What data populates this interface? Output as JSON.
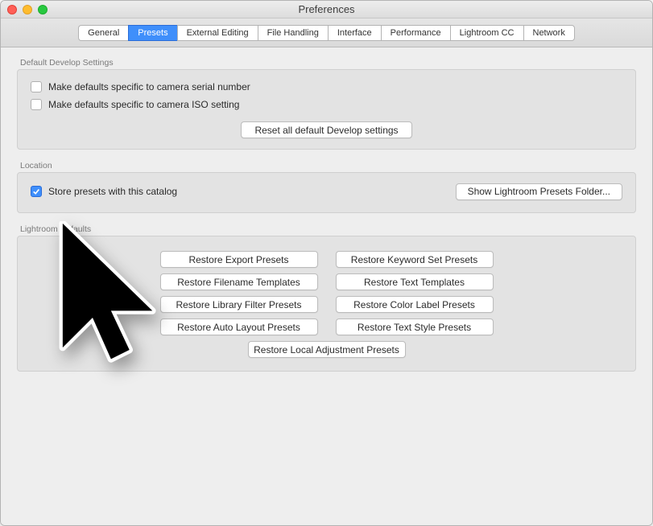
{
  "window": {
    "title": "Preferences"
  },
  "tabs": [
    "General",
    "Presets",
    "External Editing",
    "File Handling",
    "Interface",
    "Performance",
    "Lightroom CC",
    "Network"
  ],
  "active_tab": "Presets",
  "groups": {
    "defaults": {
      "title": "Default Develop Settings",
      "chk_serial": "Make defaults specific to camera serial number",
      "chk_iso": "Make defaults specific to camera ISO setting",
      "reset_btn": "Reset all default Develop settings"
    },
    "location": {
      "title": "Location",
      "chk_store": "Store presets with this catalog",
      "chk_store_checked": true,
      "show_folder_btn": "Show Lightroom Presets Folder..."
    },
    "lrdefaults": {
      "title": "Lightroom Defaults",
      "left": [
        "Restore Export Presets",
        "Restore Filename Templates",
        "Restore Library Filter Presets",
        "Restore Auto Layout Presets"
      ],
      "right": [
        "Restore Keyword Set Presets",
        "Restore Text Templates",
        "Restore Color Label Presets",
        "Restore Text Style Presets"
      ],
      "bottom": "Restore Local Adjustment Presets"
    }
  }
}
